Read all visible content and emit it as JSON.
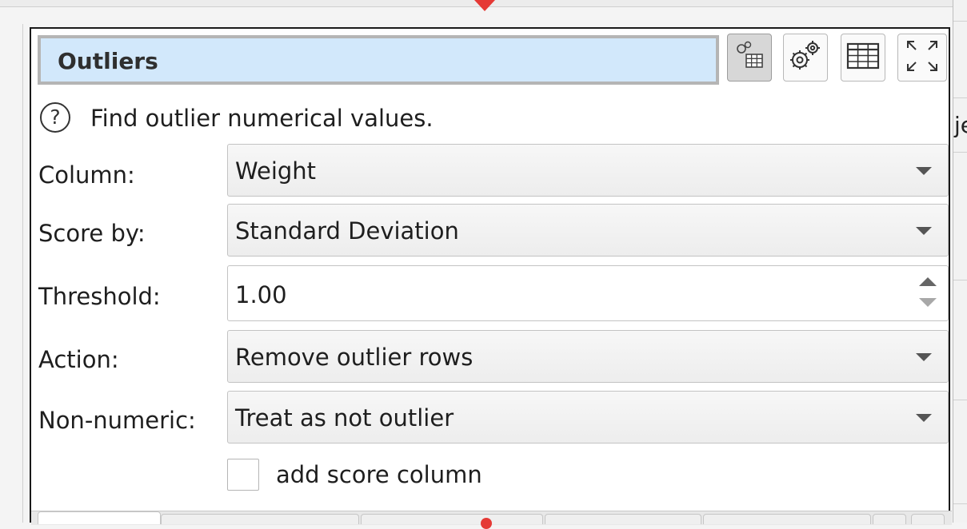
{
  "panel": {
    "title": "Outliers",
    "description": "Find outlier numerical values.",
    "toolbar": {
      "icons": [
        "gears-table-icon",
        "gears-icon",
        "table-icon",
        "expand-arrows-icon"
      ]
    }
  },
  "form": {
    "column": {
      "label": "Column:",
      "value": "Weight"
    },
    "score_by": {
      "label": "Score by:",
      "value": "Standard Deviation"
    },
    "threshold": {
      "label": "Threshold:",
      "value": "1.00"
    },
    "action": {
      "label": "Action:",
      "value": "Remove outlier rows"
    },
    "non_numeric": {
      "label": "Non-numeric:",
      "value": "Treat as not outlier"
    },
    "add_score": {
      "label": "add score column",
      "checked": false
    }
  },
  "background": {
    "clipped_text": "je"
  },
  "colors": {
    "title_bg": "#d2e8fb",
    "drop_marker": "#e53935"
  }
}
